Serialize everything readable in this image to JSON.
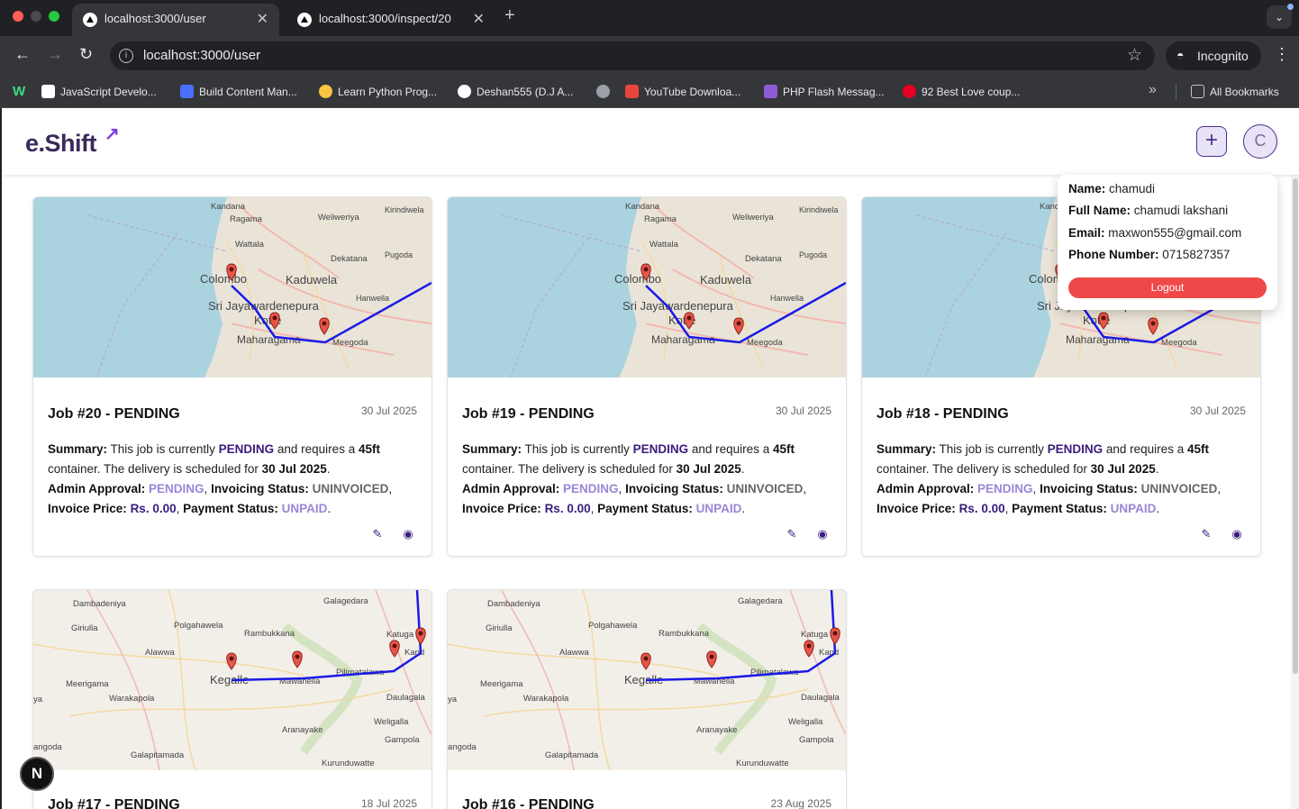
{
  "browser": {
    "tabs": [
      {
        "title": "localhost:3000/user",
        "active": true
      },
      {
        "title": "localhost:3000/inspect/20",
        "active": false
      }
    ],
    "url": "localhost:3000/user",
    "incognito_label": "Incognito",
    "bookmarks": [
      {
        "label": "JavaScript Develo...",
        "color": "#ffffff"
      },
      {
        "label": "Build Content Man...",
        "color": "#4b6fff"
      },
      {
        "label": "Learn Python Prog...",
        "color": "#f6c443"
      },
      {
        "label": "Deshan555 (D.J A...",
        "color": "#ffffff"
      },
      {
        "label": "",
        "color": "#9aa0a6"
      },
      {
        "label": "YouTube Downloa...",
        "color": "#e8453c"
      },
      {
        "label": "PHP Flash Messag...",
        "color": "#8e5bd6"
      },
      {
        "label": "92 Best Love coup...",
        "color": "#e60023"
      }
    ],
    "all_bookmarks_label": "All Bookmarks"
  },
  "app": {
    "logo": "e.Shift",
    "avatar_initial": "C"
  },
  "user_popup": {
    "name_label": "Name:",
    "name": "chamudi",
    "full_name_label": "Full Name:",
    "full_name": "chamudi lakshani",
    "email_label": "Email:",
    "email": "maxwon555@gmail.com",
    "phone_label": "Phone Number:",
    "phone": "0715827357",
    "logout_label": "Logout"
  },
  "jobs": [
    {
      "title": "Job #20 - PENDING",
      "date": "30 Jul 2025",
      "summary_label": "Summary:",
      "t1": "This job is currently",
      "status": "PENDING",
      "t2": "and requires a",
      "container": "45ft",
      "t3": "container. The delivery is scheduled for",
      "scheduled": "30 Jul 2025",
      "approval_label": "Admin Approval:",
      "approval": "PENDING",
      "invoicing_label": "Invoicing Status:",
      "invoicing": "UNINVOICED",
      "price_label": "Invoice Price:",
      "price": "Rs. 0.00",
      "payment_label": "Payment Status:",
      "payment": "UNPAID"
    },
    {
      "title": "Job #19 - PENDING",
      "date": "30 Jul 2025",
      "summary_label": "Summary:",
      "t1": "This job is currently",
      "status": "PENDING",
      "t2": "and requires a",
      "container": "45ft",
      "t3": "container. The delivery is scheduled for",
      "scheduled": "30 Jul 2025",
      "approval_label": "Admin Approval:",
      "approval": "PENDING",
      "invoicing_label": "Invoicing Status:",
      "invoicing": "UNINVOICED",
      "price_label": "Invoice Price:",
      "price": "Rs. 0.00",
      "payment_label": "Payment Status:",
      "payment": "UNPAID"
    },
    {
      "title": "Job #18 - PENDING",
      "date": "30 Jul 2025",
      "summary_label": "Summary:",
      "t1": "This job is currently",
      "status": "PENDING",
      "t2": "and requires a",
      "container": "45ft",
      "t3": "container. The delivery is scheduled for",
      "scheduled": "30 Jul 2025",
      "approval_label": "Admin Approval:",
      "approval": "PENDING",
      "invoicing_label": "Invoicing Status:",
      "invoicing": "UNINVOICED",
      "price_label": "Invoice Price:",
      "price": "Rs. 0.00",
      "payment_label": "Payment Status:",
      "payment": "UNPAID"
    },
    {
      "title": "Job #17 - PENDING",
      "date": "18 Jul 2025"
    },
    {
      "title": "Job #16 - PENDING",
      "date": "23 Aug 2025"
    }
  ],
  "map_colombo": {
    "labels": [
      "Kandana",
      "Ragama",
      "Weliweriya",
      "Kirindiwela",
      "Wattala",
      "Dekatana",
      "Pugoda",
      "Colombo",
      "Kaduwela",
      "Hanwella",
      "Sri Jayawardenepura",
      "Kotte",
      "Maharagama",
      "Meegoda"
    ]
  },
  "map_kegalle": {
    "labels": [
      "Dambadeniya",
      "Galagedara",
      "Giriulla",
      "Polgahawela",
      "Rambukkana",
      "Katuga",
      "Alawwa",
      "Kand",
      "Meerigama",
      "Kegalle",
      "Mawanella",
      "Pilimatalawa",
      "Warakapola",
      "Daulagala",
      "ya",
      "Aranayake",
      "Weligalla",
      "angoda",
      "Gampola",
      "Galapitamada",
      "Kurunduwatte"
    ]
  },
  "colors": {
    "primary": "#3a1c7c",
    "lavender": "#9b85d6",
    "logout": "#f04848",
    "route": "#1a1ae6"
  },
  "dev_badge": "N"
}
